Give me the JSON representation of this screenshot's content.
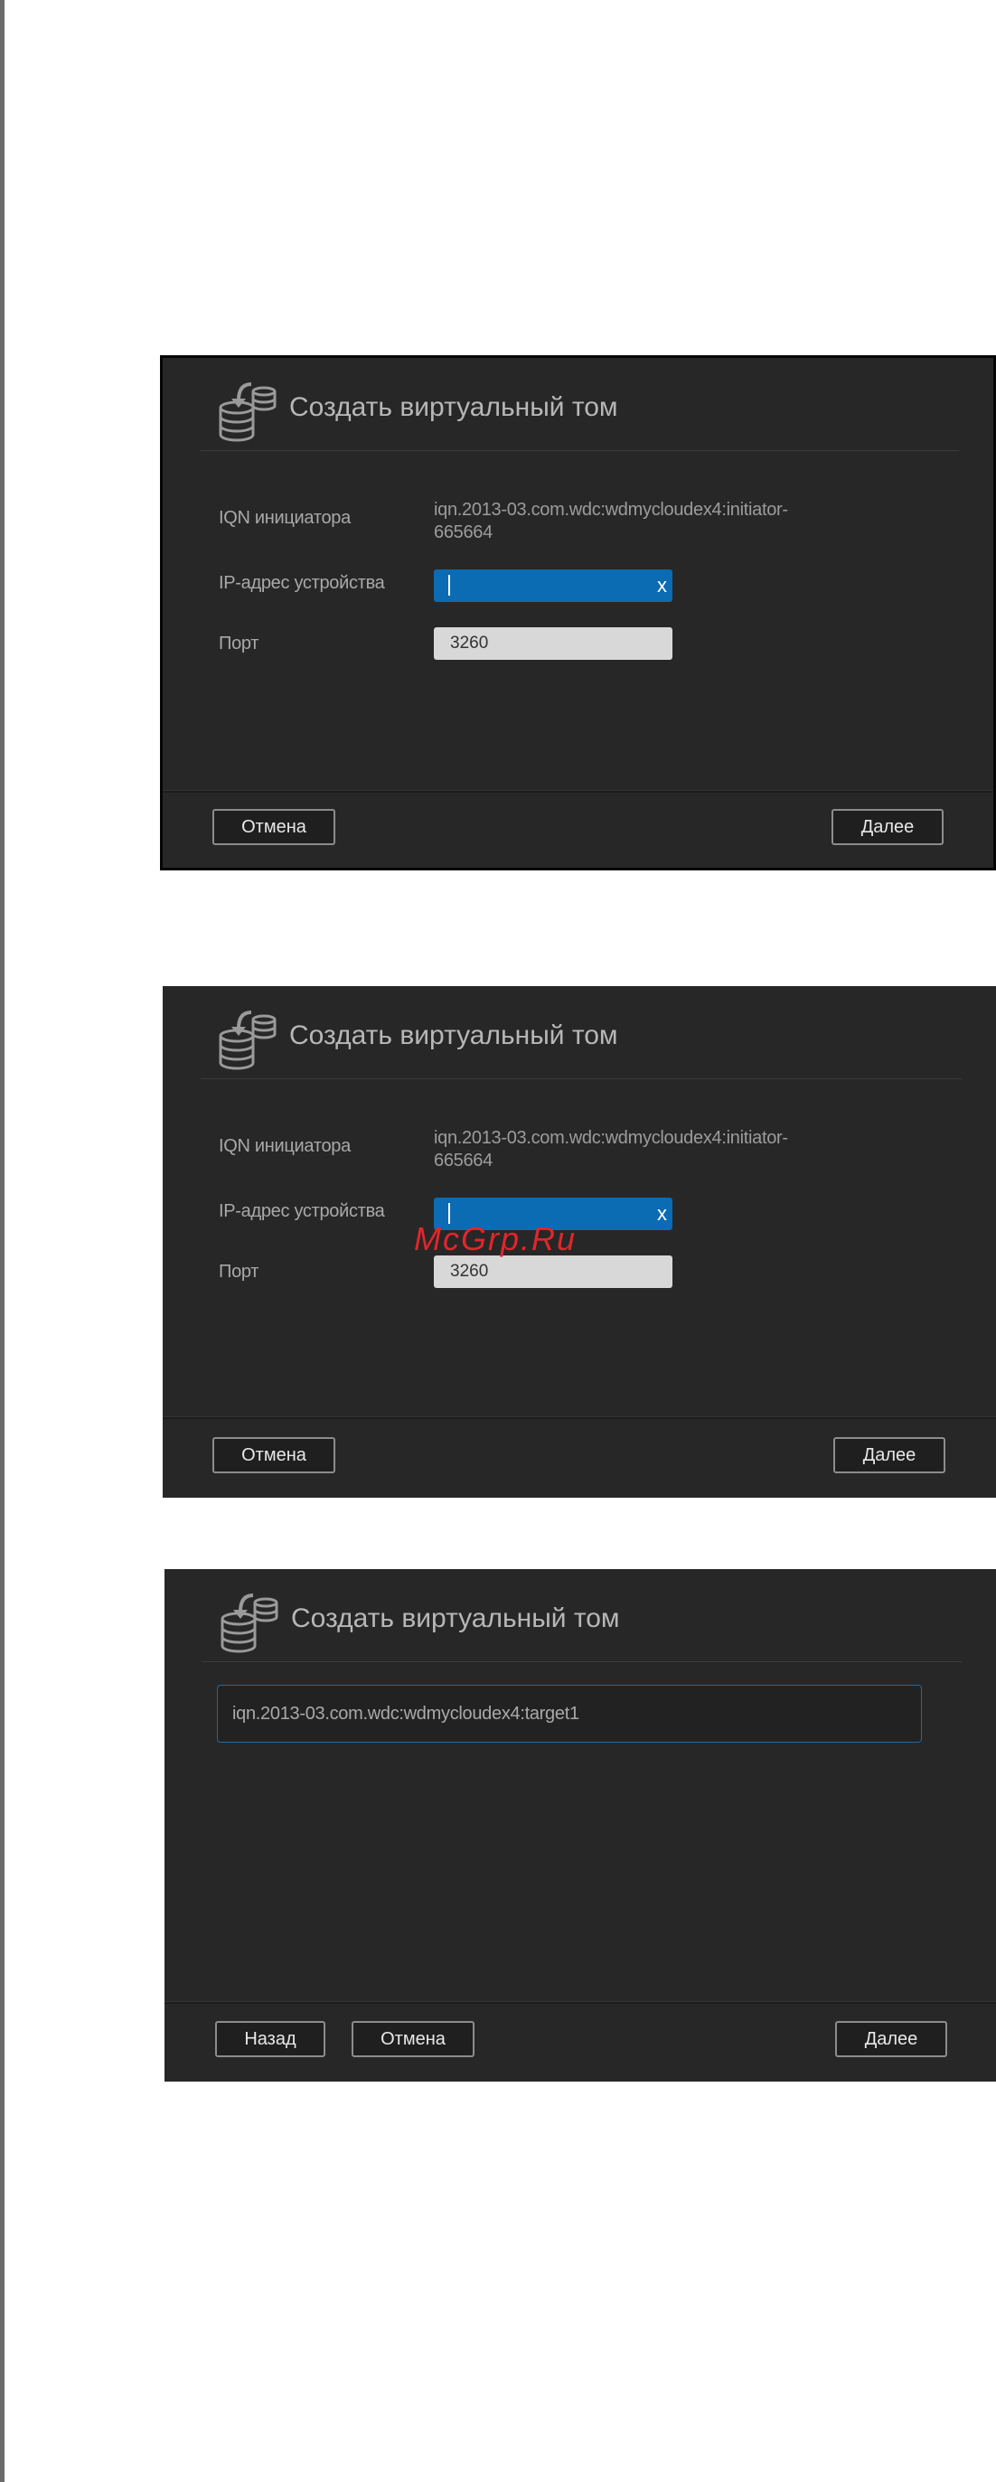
{
  "dialog1": {
    "title": "Создать виртуальный том",
    "iqn_label": "IQN инициатора",
    "iqn_value": "iqn.2013-03.com.wdc:wdmycloudex4:initiator-665664",
    "ip_label": "IP-адрес устройства",
    "ip_value": "",
    "clear_symbol": "x",
    "port_label": "Порт",
    "port_value": "3260",
    "cancel": "Отмена",
    "next": "Далее"
  },
  "dialog2": {
    "title": "Создать виртуальный том",
    "iqn_label": "IQN инициатора",
    "iqn_value": "iqn.2013-03.com.wdc:wdmycloudex4:initiator-665664",
    "ip_label": "IP-адрес устройства",
    "ip_value": "",
    "clear_symbol": "x",
    "port_label": "Порт",
    "port_value": "3260",
    "cancel": "Отмена",
    "next": "Далее"
  },
  "dialog3": {
    "title": "Создать виртуальный том",
    "target_value": "iqn.2013-03.com.wdc:wdmycloudex4:target1",
    "back": "Назад",
    "cancel": "Отмена",
    "next": "Далее"
  },
  "watermark": "McGrp.Ru",
  "colors": {
    "dialog_bg": "#272727",
    "accent_blue": "#0b6bb3",
    "watermark_red": "#e0262b"
  },
  "icons": {
    "dialog_icon": "database-arrow-icon",
    "clear_icon": "close-icon"
  }
}
